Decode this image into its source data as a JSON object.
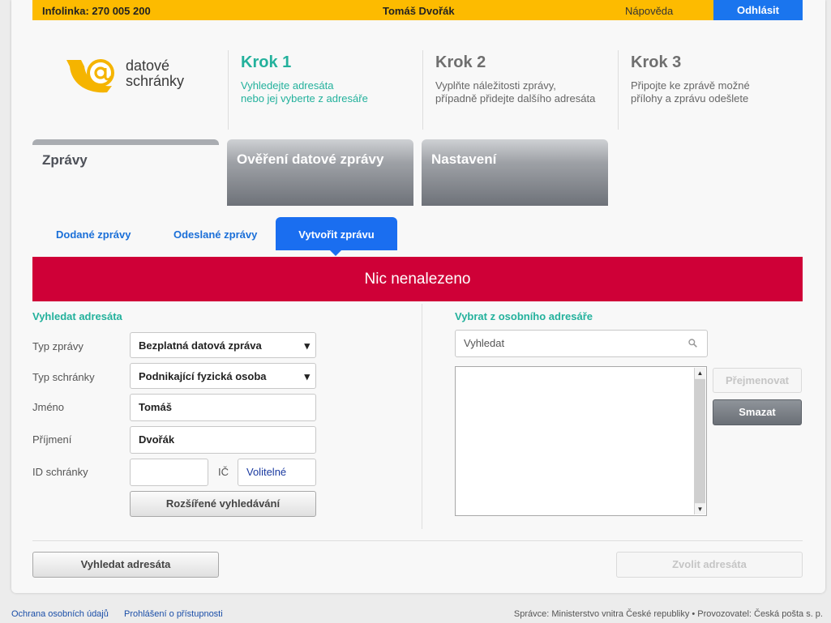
{
  "topbar": {
    "infoline": "Infolinka: 270 005 200",
    "user": "Tomáš Dvořák",
    "help": "Nápověda",
    "logout": "Odhlásit"
  },
  "logo": {
    "line1": "datové",
    "line2": "schránky"
  },
  "steps": [
    {
      "title": "Krok 1",
      "line1": "Vyhledejte adresáta",
      "line2": "nebo jej vyberte z adresáře"
    },
    {
      "title": "Krok 2",
      "line1": "Vyplňte náležitosti zprávy,",
      "line2": "případně přidejte dalšího adresáta"
    },
    {
      "title": "Krok 3",
      "line1": "Připojte ke zprávě možné",
      "line2": "přílohy a zprávu odešlete"
    }
  ],
  "main_tabs": [
    "Zprávy",
    "Ověření datové zprávy",
    "Nastavení"
  ],
  "sub_tabs": [
    "Dodané zprávy",
    "Odeslané zprávy",
    "Vytvořit zprávu"
  ],
  "banner": "Nic nenalezeno",
  "search_form": {
    "title": "Vyhledat adresáta",
    "labels": {
      "type": "Typ zprávy",
      "box_type": "Typ schránky",
      "first_name": "Jméno",
      "last_name": "Příjmení",
      "box_id": "ID schránky",
      "ic": "IČ"
    },
    "values": {
      "type": "Bezplatná datová zpráva",
      "box_type": "Podnikající fyzická osoba",
      "first_name": "Tomáš",
      "last_name": "Dvořák",
      "box_id": "",
      "ic_placeholder": "Volitelné"
    },
    "advanced_button": "Rozšířené vyhledávání"
  },
  "address_book": {
    "title": "Vybrat z osobního adresáře",
    "search_placeholder": "Vyhledat",
    "rename_button": "Přejmenovat",
    "delete_button": "Smazat"
  },
  "actions": {
    "search_button": "Vyhledat adresáta",
    "choose_button": "Zvolit adresáta"
  },
  "footer": {
    "privacy": "Ochrana osobních údajů",
    "accessibility": "Prohlášení o přístupnosti",
    "operator": "Správce: Ministerstvo vnitra České republiky • Provozovatel: Česká pošta s. p."
  },
  "colors": {
    "topbar": "#fdbb00",
    "logout": "#1a75ee",
    "accent_green": "#23b19c",
    "banner": "#cf0037",
    "active_subtab": "#1a6ef0"
  }
}
